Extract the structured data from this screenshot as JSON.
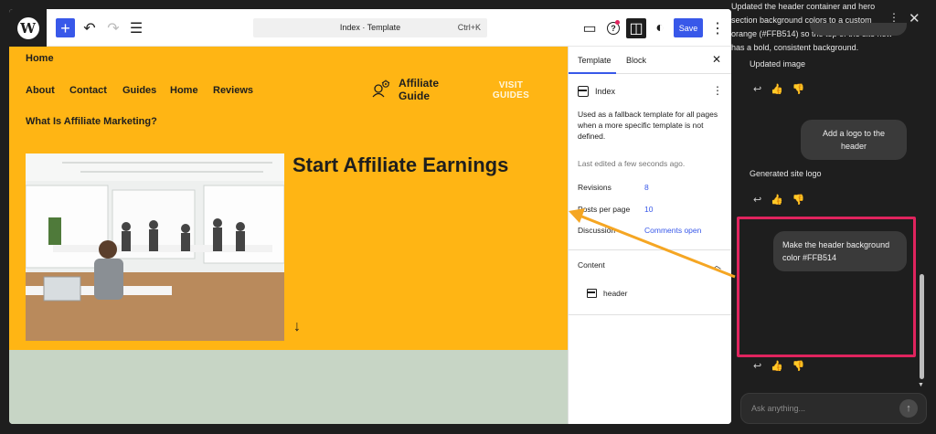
{
  "toolbar": {
    "logo_glyph": "W",
    "add_glyph": "+",
    "undo_glyph": "↶",
    "redo_glyph": "↷",
    "outline_glyph": "☰",
    "command_title": "Index · Template",
    "command_shortcut": "Ctrl+K",
    "view_glyph": "▭",
    "help_glyph": "?",
    "sidebar_glyph": "◫",
    "styles_glyph": "◐",
    "save_label": "Save",
    "options_glyph": "⋮"
  },
  "canvas": {
    "header_bg": "#FFB514",
    "body_bg": "#c7d5c5",
    "site_link": "Home",
    "nav": [
      "About",
      "Contact",
      "Guides",
      "Home",
      "Reviews"
    ],
    "nav_secondary": "What Is Affiliate Marketing?",
    "logo_text": "Affiliate Guide",
    "visit_button": "VISIT GUIDES",
    "hero_heading": "Start Affiliate Earnings",
    "scroll_glyph": "↓"
  },
  "settings": {
    "tabs": [
      "Template",
      "Block"
    ],
    "close_glyph": "✕",
    "template_name": "Index",
    "more_glyph": "⋮",
    "description": "Used as a fallback template for all pages when a more specific template is not defined.",
    "last_edited": "Last edited a few seconds ago.",
    "properties": [
      {
        "label": "Revisions",
        "value": "8"
      },
      {
        "label": "Posts per page",
        "value": "10"
      },
      {
        "label": "Discussion",
        "value": "Comments open"
      }
    ],
    "content_title": "Content",
    "content_chevron": "︿",
    "content_item": "header"
  },
  "chat": {
    "more_glyph": "⋮",
    "close_glyph": "✕",
    "messages": [
      {
        "role": "assistant",
        "text": "Updated image"
      },
      {
        "role": "user",
        "text": "Add a logo to the header"
      },
      {
        "role": "assistant",
        "text": "Generated site logo"
      },
      {
        "role": "user",
        "text": "Make the header background color #FFB514"
      },
      {
        "role": "assistant",
        "text": "Updated the header container and hero section background colors to a custom orange (#FFB514) so the top of the site now has a bold, consistent background."
      }
    ],
    "reaction_glyphs": {
      "reply": "↩",
      "like": "👍",
      "dislike": "👎"
    },
    "input_placeholder": "Ask anything...",
    "send_glyph": "↑",
    "scroll_down_glyph": "▼",
    "highlight_color": "#e0245e",
    "arrow_color": "#f5a623"
  }
}
